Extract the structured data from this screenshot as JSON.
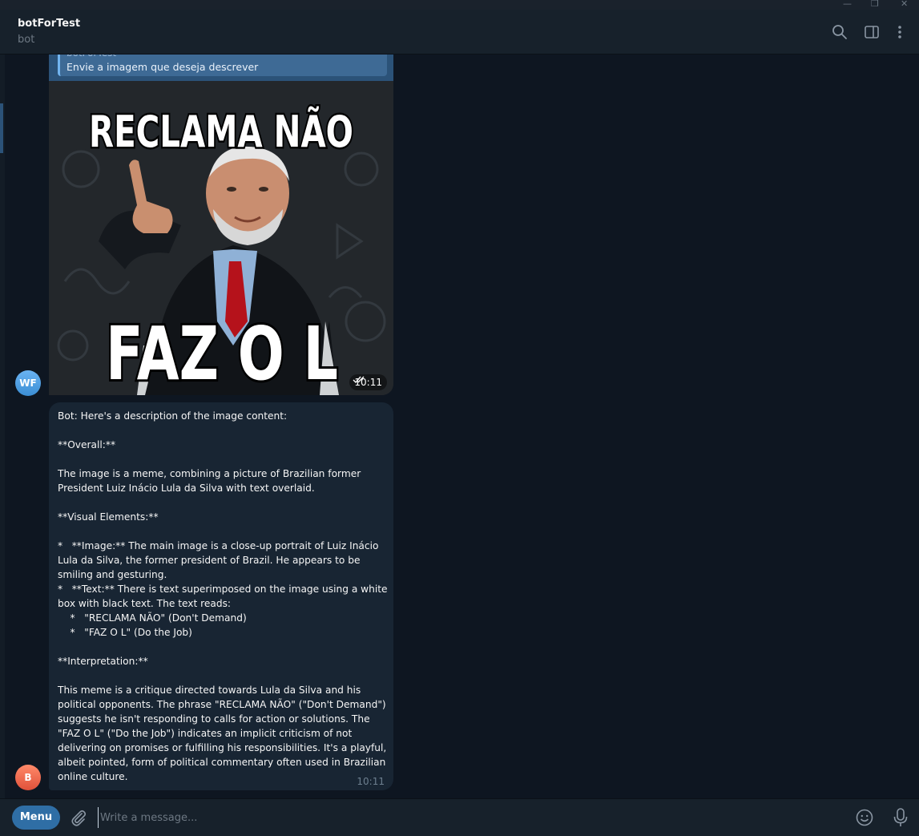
{
  "header": {
    "title": "botForTest",
    "subtitle": "bot"
  },
  "reply": {
    "sender": "botForTest",
    "text": "Envie a imagem que deseja descrever"
  },
  "image_message": {
    "meme_top_text": "RECLAMA NÃO",
    "meme_bottom_text": "FAZ O L",
    "time": "10:11",
    "status_icon": "double-check-icon"
  },
  "avatars": {
    "user": "WF",
    "bot": "B"
  },
  "bot_message": {
    "text": "Bot: Here's a description of the image content:\n\n**Overall:**\n\nThe image is a meme, combining a picture of Brazilian former President Luiz Inácio Lula da Silva with text overlaid.\n\n**Visual Elements:**\n\n*   **Image:** The main image is a close-up portrait of Luiz Inácio Lula da Silva, the former president of Brazil. He appears to be smiling and gesturing.\n*   **Text:** There is text superimposed on the image using a white box with black text. The text reads:\n    *   \"RECLAMA NÃO\" (Don't Demand)\n    *   \"FAZ O L\" (Do the Job)\n\n**Interpretation:**\n\nThis meme is a critique directed towards Lula da Silva and his political opponents. The phrase \"RECLAMA NÃO\" (\"Don't Demand\") suggests he isn't responding to calls for action or solutions. The \"FAZ O L\" (\"Do the Job\") indicates an implicit criticism of not delivering on promises or fulfilling his responsibilities. It's a playful, albeit pointed, form of political commentary often used in Brazilian online culture.",
    "time": "10:11"
  },
  "composer": {
    "menu_label": "Menu",
    "placeholder": "Write a message..."
  },
  "icons": {
    "search": "search-icon",
    "sidebar": "sidebar-toggle-icon",
    "more": "more-vertical-icon",
    "attach": "paperclip-icon",
    "emoji": "emoji-icon",
    "mic": "microphone-icon"
  },
  "colors": {
    "background": "#0e1621",
    "header": "#17212b",
    "outgoing": "#2b5278",
    "incoming": "#182533",
    "accent": "#2f6ea5"
  }
}
